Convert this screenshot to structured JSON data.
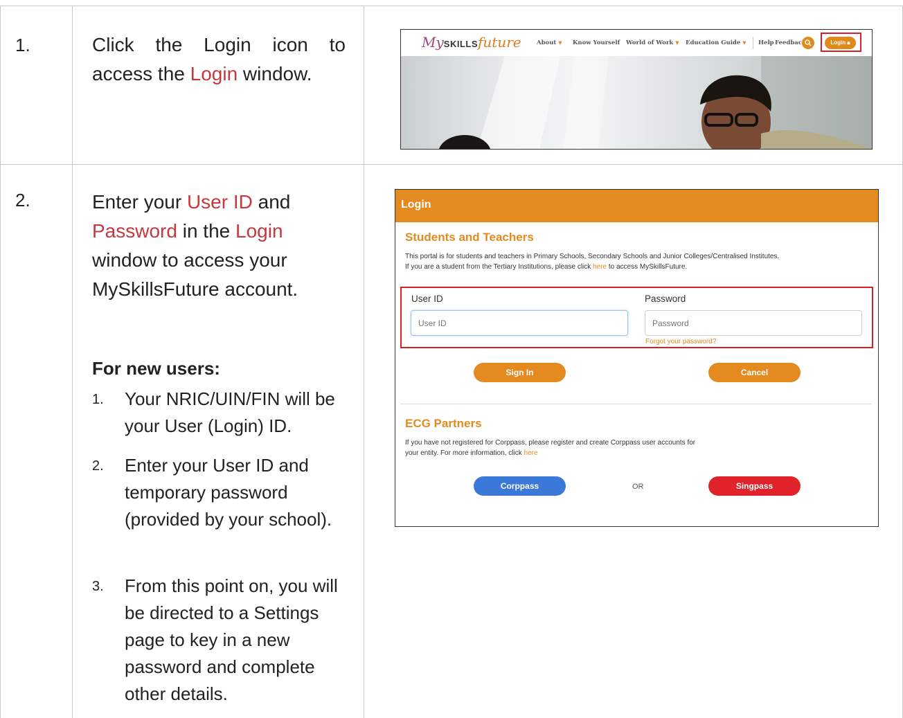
{
  "steps": [
    {
      "number": "1.",
      "instruction": {
        "pre": "Click the Login icon to",
        "line2_pre": "access the ",
        "highlight": "Login",
        "post": " window."
      }
    },
    {
      "number": "2.",
      "instruction": {
        "l1_pre": "Enter your ",
        "l1_hl": "User ID",
        "l1_post": " and",
        "l2_hl1": "Password",
        "l2_mid": " in the ",
        "l2_hl2": "Login",
        "l3": "window to access your",
        "l4": "MySkillsFuture account."
      },
      "new_users_title": "For new users:",
      "new_users_items": [
        {
          "num": "1.",
          "text": "Your NRIC/UIN/FIN will be your User (Login) ID."
        },
        {
          "num": "2.",
          "text": "Enter your User ID and temporary password (provided by your school)."
        },
        {
          "num": "3.",
          "text": "From this point on, you will be directed to a Settings page to key in a new password and complete other details."
        }
      ]
    }
  ],
  "screenshot1": {
    "logo": {
      "my": "My",
      "skills": "SKILLS",
      "future": "future"
    },
    "nav": [
      {
        "label": "About",
        "dropdown": true
      },
      {
        "label": "Know Yourself",
        "dropdown": false
      },
      {
        "label": "World of Work",
        "dropdown": true
      },
      {
        "label": "Education Guide",
        "dropdown": true
      },
      {
        "label": "Help",
        "dropdown": false
      },
      {
        "label": "Feedback",
        "dropdown": false
      }
    ],
    "login_button": "Login",
    "accent": "#e08a1c"
  },
  "screenshot2": {
    "header": "Login",
    "section_title": "Students and Teachers",
    "desc_line1": "This portal is for students and teachers in Primary Schools, Secondary Schools and Junior Colleges/Centralised Institutes.",
    "desc_line2_pre": "If you are a student from the Tertiary Institutions, please click ",
    "desc_line2_link": "here",
    "desc_line2_post": " to access MySkillsFuture.",
    "user_id_label": "User ID",
    "user_id_placeholder": "User ID",
    "password_label": "Password",
    "password_placeholder": "Password",
    "forgot": "Forgot your password?",
    "sign_in": "Sign In",
    "cancel": "Cancel",
    "ecg_title": "ECG Partners",
    "ecg_line1": "If you have not registered for Corppass, please register and create Corppass user accounts for",
    "ecg_line2_pre": "your entity. For more information, click ",
    "ecg_link": "here",
    "corppass": "Corppass",
    "or": "OR",
    "singpass": "Singpass",
    "colors": {
      "orange": "#e58a1f",
      "corppass": "#3a79d8",
      "singpass": "#e0222b",
      "highlight_box": "#d62025"
    }
  }
}
